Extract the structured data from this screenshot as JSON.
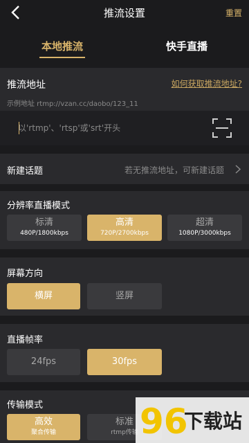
{
  "header": {
    "title": "推流设置",
    "reset_label": "重置"
  },
  "tabs": [
    {
      "label": "本地推流",
      "active": true
    },
    {
      "label": "快手直播",
      "active": false
    }
  ],
  "push_address": {
    "title": "推流地址",
    "help_link": "如何获取推流地址?",
    "example": "示例地址 rtmp://vzan.cc/daobo/123_11",
    "placeholder": "以'rtmp'、'rtsp'或'srt'开头"
  },
  "new_topic": {
    "label": "新建话题",
    "value": "若无推流地址，可新建话题"
  },
  "resolution": {
    "title": "分辨率直播模式",
    "options": [
      {
        "label": "标清",
        "sub": "480P/1800kbps",
        "selected": false
      },
      {
        "label": "高清",
        "sub": "720P/2700kbps",
        "selected": true
      },
      {
        "label": "超清",
        "sub": "1080P/3000kbps",
        "selected": false
      }
    ]
  },
  "orientation": {
    "title": "屏幕方向",
    "options": [
      {
        "label": "横屏",
        "selected": true
      },
      {
        "label": "竖屏",
        "selected": false
      }
    ]
  },
  "framerate": {
    "title": "直播帧率",
    "options": [
      {
        "label": "24fps",
        "selected": false
      },
      {
        "label": "30fps",
        "selected": true
      }
    ]
  },
  "transport": {
    "title": "传输模式",
    "options": [
      {
        "label": "高效",
        "sub": "聚合传输",
        "selected": true
      },
      {
        "label": "标准",
        "sub": "rtmp传输",
        "selected": false
      }
    ]
  },
  "watermark": {
    "text": "下载站",
    "digits": "96",
    "icon": "96xz-logo"
  },
  "colors": {
    "accent": "#d9b46a",
    "background": "#1b1b1d",
    "panel": "#2a2a2d",
    "option": "#3a3a3d"
  }
}
